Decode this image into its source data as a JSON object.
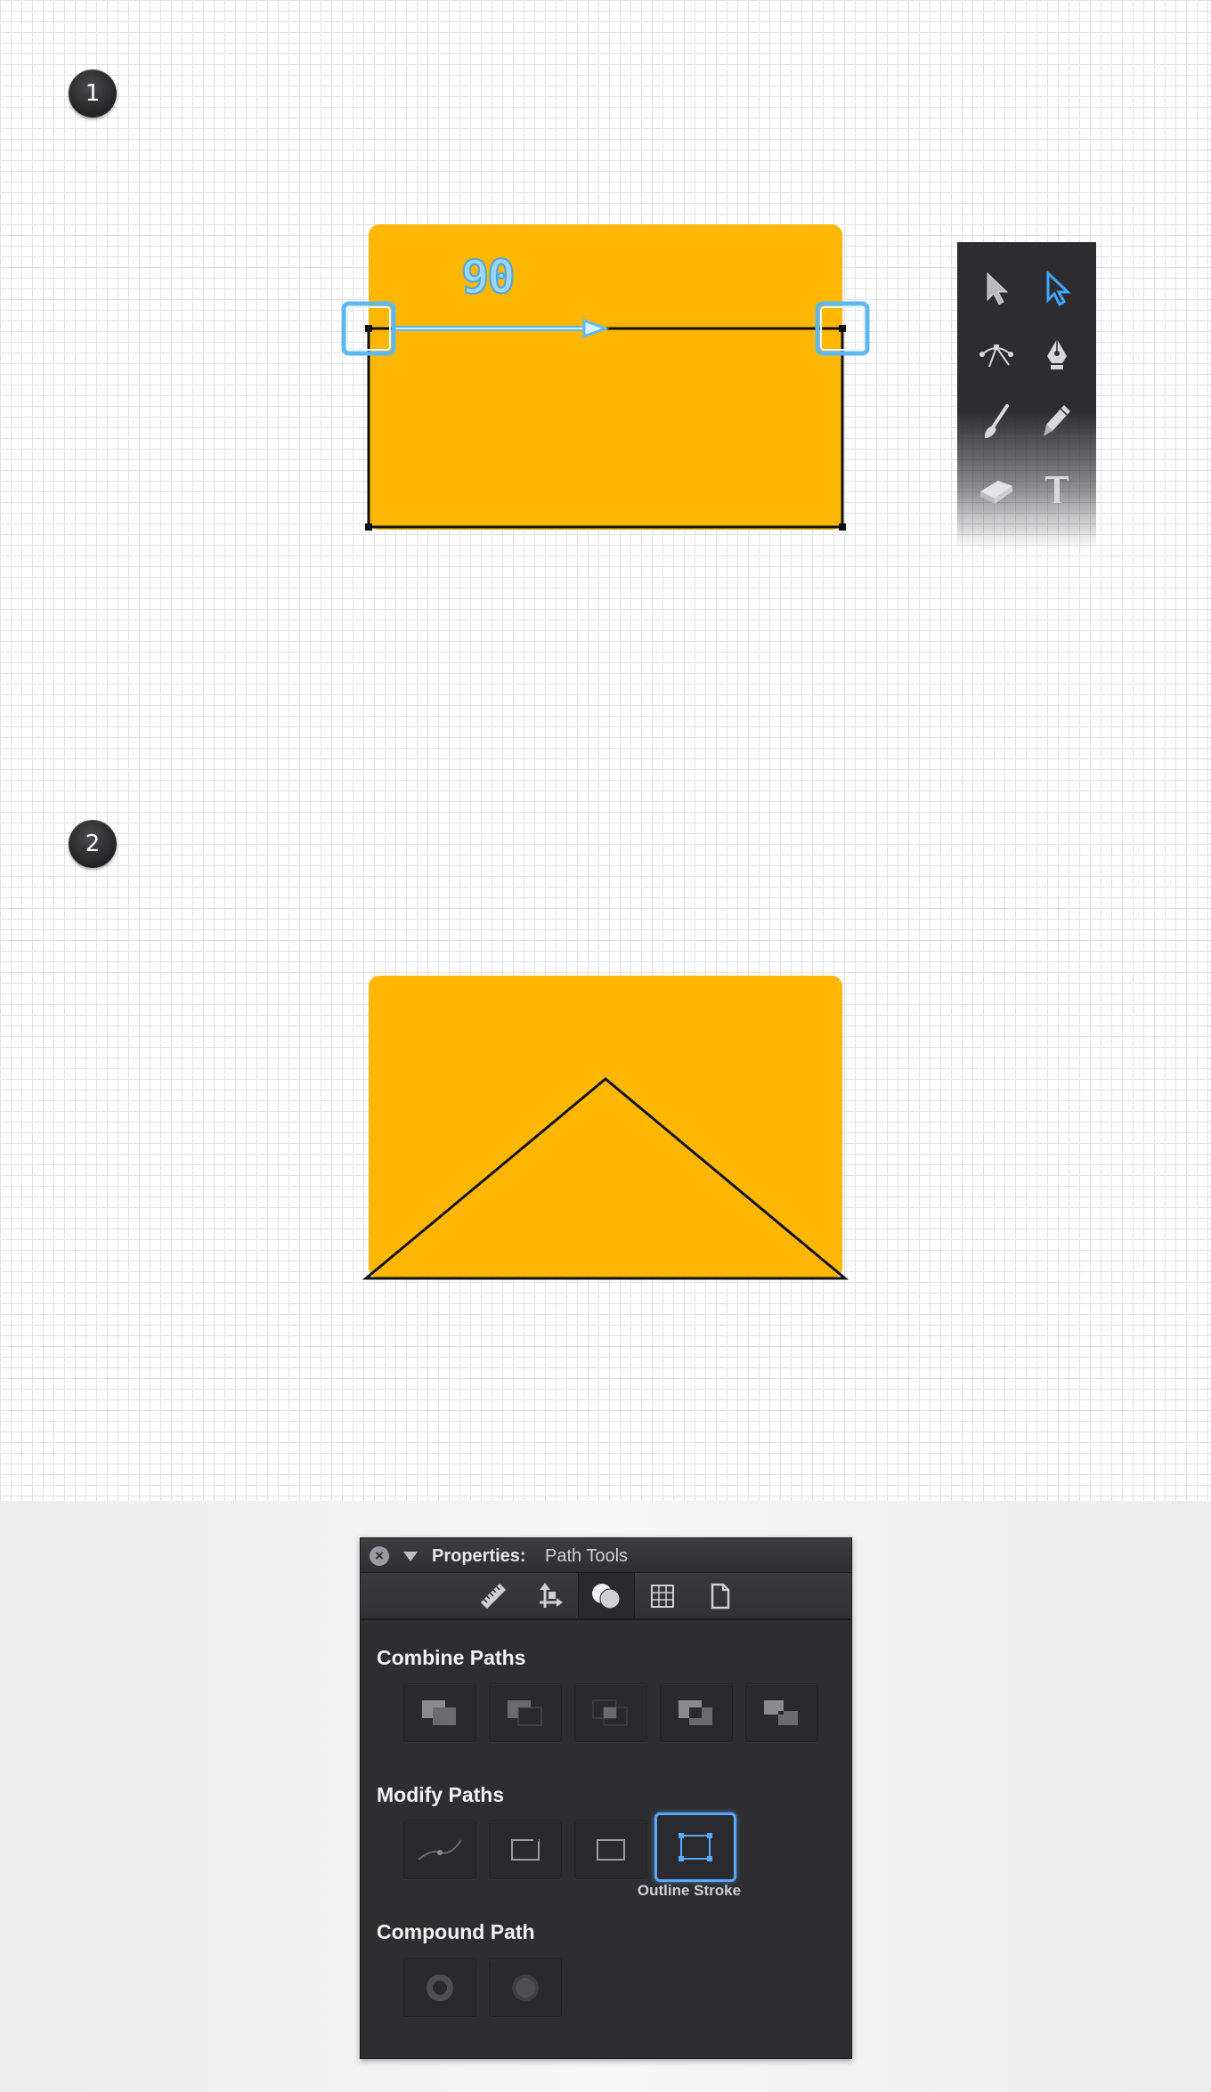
{
  "steps": {
    "step1": "1",
    "step2": "2"
  },
  "canvas": {
    "angle_readout": "90",
    "shape_fill": "#FFB703",
    "guide_color": "#5DB8F0"
  },
  "toolbox": {
    "tools": [
      {
        "name": "selection-arrow-icon",
        "active": false
      },
      {
        "name": "direct-selection-arrow-icon",
        "active": true
      },
      {
        "name": "transform-nodes-icon",
        "active": false
      },
      {
        "name": "pen-tool-icon",
        "active": false
      },
      {
        "name": "brush-icon",
        "active": false
      },
      {
        "name": "pencil-icon",
        "active": false
      },
      {
        "name": "eraser-icon",
        "active": false
      },
      {
        "name": "text-tool-icon",
        "active": false
      }
    ]
  },
  "panel": {
    "close_glyph": "×",
    "title": "Properties:",
    "subtitle": "Path Tools",
    "tabs": [
      {
        "name": "ruler-icon",
        "active": false
      },
      {
        "name": "arrange-icon",
        "active": false
      },
      {
        "name": "path-tools-icon",
        "active": true
      },
      {
        "name": "grid-icon",
        "active": false
      },
      {
        "name": "document-icon",
        "active": false
      }
    ],
    "combine_title": "Combine Paths",
    "modify_title": "Modify Paths",
    "compound_title": "Compound Path",
    "selected_caption": "Outline Stroke",
    "accent": "#5AA8FF"
  }
}
